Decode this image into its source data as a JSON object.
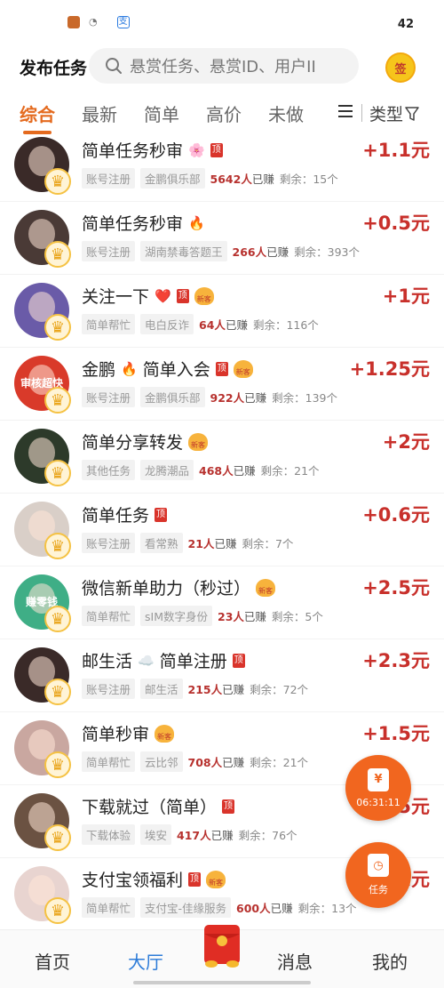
{
  "status_bar": {
    "battery": "42"
  },
  "header": {
    "title": "发布任务",
    "search_placeholder": "悬赏任务、悬赏ID、用户II",
    "checkin_label": "签"
  },
  "tabs": [
    {
      "label": "综合",
      "active": true
    },
    {
      "label": "最新",
      "active": false
    },
    {
      "label": "简单",
      "active": false
    },
    {
      "label": "高价",
      "active": false
    },
    {
      "label": "未做",
      "active": false
    }
  ],
  "type_filter": "类型",
  "badges": {
    "top": "顶",
    "new": "新客"
  },
  "tasks": [
    {
      "title": "简单任务秒审",
      "emoji": "🌸",
      "top": true,
      "new_badge": false,
      "reward": "+1.1元",
      "tag1": "账号注册",
      "tag2": "金鹏俱乐部",
      "earned_num": "5642人",
      "earned_suffix": "已赚",
      "remaining": "剩余：15个",
      "avatar_color": "#3a2a28"
    },
    {
      "title": "简单任务秒审",
      "emoji": "🔥",
      "top": false,
      "new_badge": false,
      "reward": "+0.5元",
      "tag1": "账号注册",
      "tag2": "湖南禁毒答题王",
      "earned_num": "266人",
      "earned_suffix": "已赚",
      "remaining": "剩余：393个",
      "avatar_color": "#4a3a36"
    },
    {
      "title": "关注一下",
      "emoji": "❤️",
      "top": true,
      "new_badge": true,
      "reward": "+1元",
      "tag1": "简单帮忙",
      "tag2": "电白反诈",
      "earned_num": "64人",
      "earned_suffix": "已赚",
      "remaining": "剩余：116个",
      "avatar_color": "#6a5ba8"
    },
    {
      "title": "金鹏",
      "emoji": "🔥",
      "title2": "简单入会",
      "top": true,
      "new_badge": true,
      "reward": "+1.25元",
      "tag1": "账号注册",
      "tag2": "金鹏俱乐部",
      "earned_num": "922人",
      "earned_suffix": "已赚",
      "remaining": "剩余：139个",
      "avatar_color": "#d93a2a",
      "avatar_text": "审核超快"
    },
    {
      "title": "简单分享转发",
      "emoji": "",
      "top": false,
      "new_badge": true,
      "reward": "+2元",
      "tag1": "其他任务",
      "tag2": "龙腾潮品",
      "earned_num": "468人",
      "earned_suffix": "已赚",
      "remaining": "剩余：21个",
      "avatar_color": "#2d3a2a"
    },
    {
      "title": "简单任务",
      "emoji": "",
      "top": true,
      "new_badge": false,
      "reward": "+0.6元",
      "tag1": "账号注册",
      "tag2": "看常熟",
      "earned_num": "21人",
      "earned_suffix": "已赚",
      "remaining": "剩余：7个",
      "avatar_color": "#d9cfc8"
    },
    {
      "title": "微信新单助力（秒过）",
      "emoji": "",
      "top": false,
      "new_badge": true,
      "reward": "+2.5元",
      "tag1": "简单帮忙",
      "tag2": "sIM数字身份",
      "earned_num": "23人",
      "earned_suffix": "已赚",
      "remaining": "剩余：5个",
      "avatar_color": "#3fae86",
      "avatar_text": "赚零钱"
    },
    {
      "title": "邮生活",
      "emoji": "☁️",
      "title2": "简单注册",
      "top": true,
      "new_badge": false,
      "reward": "+2.3元",
      "tag1": "账号注册",
      "tag2": "邮生活",
      "earned_num": "215人",
      "earned_suffix": "已赚",
      "remaining": "剩余：72个",
      "avatar_color": "#3a2a28"
    },
    {
      "title": "简单秒审",
      "emoji": "",
      "top": false,
      "new_badge": true,
      "reward": "+1.5元",
      "tag1": "简单帮忙",
      "tag2": "云比邻",
      "earned_num": "708人",
      "earned_suffix": "已赚",
      "remaining": "剩余：21个",
      "avatar_color": "#c9a7a0"
    },
    {
      "title": "下载就过（简单）",
      "emoji": "",
      "top": true,
      "new_badge": false,
      "reward": "+5元",
      "tag1": "下载体验",
      "tag2": "埃安",
      "earned_num": "417人",
      "earned_suffix": "已赚",
      "remaining": "剩余：76个",
      "avatar_color": "#6b5242"
    },
    {
      "title": "支付宝领福利",
      "emoji": "",
      "top": true,
      "new_badge": true,
      "reward": "+1元",
      "tag1": "简单帮忙",
      "tag2": "支付宝-佳缘服务",
      "earned_num": "600人",
      "earned_suffix": "已赚",
      "remaining": "剩余：13个",
      "avatar_color": "#e8d4d0"
    }
  ],
  "float_timer": {
    "icon": "¥",
    "label": "06:31:11"
  },
  "float_task": {
    "label": "任务"
  },
  "bottom_nav": [
    {
      "label": "首页",
      "active": false
    },
    {
      "label": "大厅",
      "active": true
    },
    {
      "label": "消息",
      "active": false
    },
    {
      "label": "我的",
      "active": false
    }
  ],
  "colors": {
    "accent": "#e46a1e",
    "reward": "#c8302b",
    "nav_active": "#2c7bd8",
    "float": "#f1661f"
  }
}
